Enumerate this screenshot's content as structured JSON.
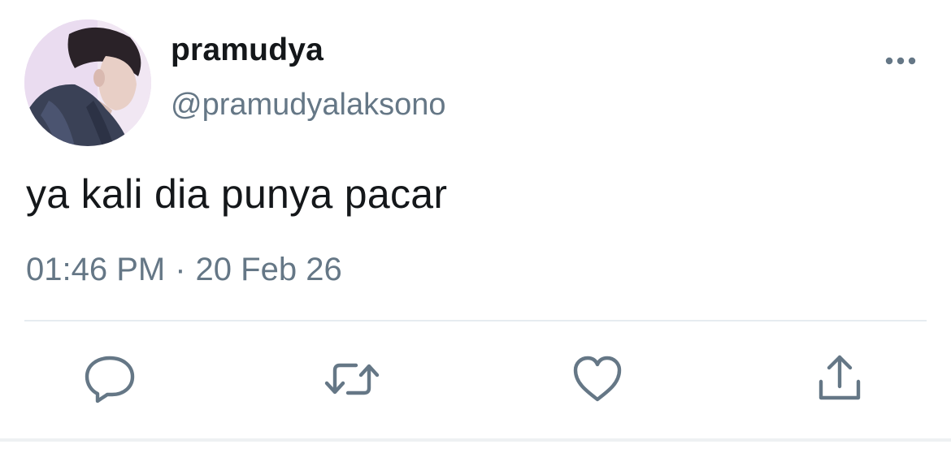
{
  "user": {
    "display_name": "pramudya",
    "handle": "@pramudyalaksono"
  },
  "tweet": {
    "text": "ya kali dia punya pacar",
    "time": "01:46 PM",
    "separator": "·",
    "date": "20 Feb 26"
  },
  "actions": {
    "icons": [
      "reply-icon",
      "retweet-icon",
      "like-icon",
      "share-icon"
    ]
  },
  "colors": {
    "text": "#14171a",
    "secondary": "#657786",
    "divider": "#e6ecf0"
  }
}
